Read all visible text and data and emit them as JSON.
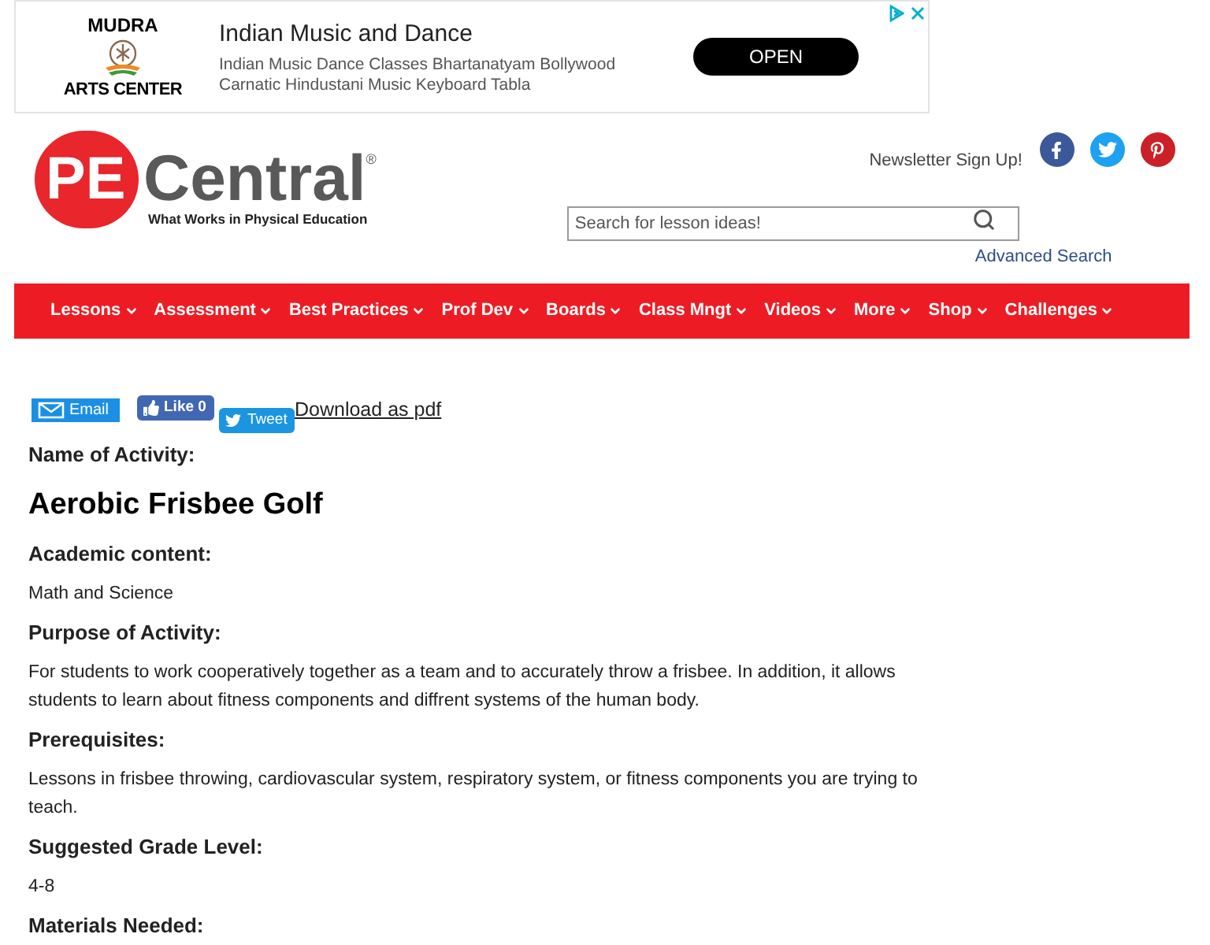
{
  "ad": {
    "brand_lines": [
      "MUDRA",
      "ARTS CENTER"
    ],
    "title": "Indian Music and Dance",
    "description": "Indian Music Dance Classes Bhartanatyam Bollywood Carnatic Hindustani Music Keyboard Tabla",
    "button": "OPEN"
  },
  "header": {
    "logo": {
      "mark": "PE",
      "name": "Central",
      "registered": "®",
      "tagline": "What Works in Physical Education"
    },
    "newsletter_link": "Newsletter Sign Up!",
    "social": [
      {
        "kind": "facebook"
      },
      {
        "kind": "twitter"
      },
      {
        "kind": "pinterest"
      }
    ],
    "search": {
      "placeholder": "Search for lesson ideas!"
    },
    "advanced_search": "Advanced Search"
  },
  "nav": {
    "items": [
      {
        "label": "Lessons"
      },
      {
        "label": "Assessment"
      },
      {
        "label": "Best Practices"
      },
      {
        "label": "Prof Dev"
      },
      {
        "label": "Boards"
      },
      {
        "label": "Class Mngt"
      },
      {
        "label": "Videos"
      },
      {
        "label": "More"
      },
      {
        "label": "Shop"
      },
      {
        "label": "Challenges"
      }
    ]
  },
  "share": {
    "email": "Email",
    "like": "Like 0",
    "tweet": "Tweet",
    "download": "Download as pdf"
  },
  "activity": {
    "name_label": "Name of Activity:",
    "name": "Aerobic Frisbee Golf",
    "sections": [
      {
        "heading": "Academic content:",
        "text": "Math and Science"
      },
      {
        "heading": "Purpose of Activity:",
        "text": "For students to work cooperatively together as a team and to accurately throw a frisbee. In addition, it allows students to learn about fitness components and diffrent systems of the human body."
      },
      {
        "heading": "Prerequisites:",
        "text": "Lessons in frisbee throwing, cardiovascular system, respiratory system, or fitness components you are trying to teach."
      },
      {
        "heading": "Suggested Grade Level:",
        "text": "4-8"
      },
      {
        "heading": "Materials Needed:"
      }
    ]
  }
}
